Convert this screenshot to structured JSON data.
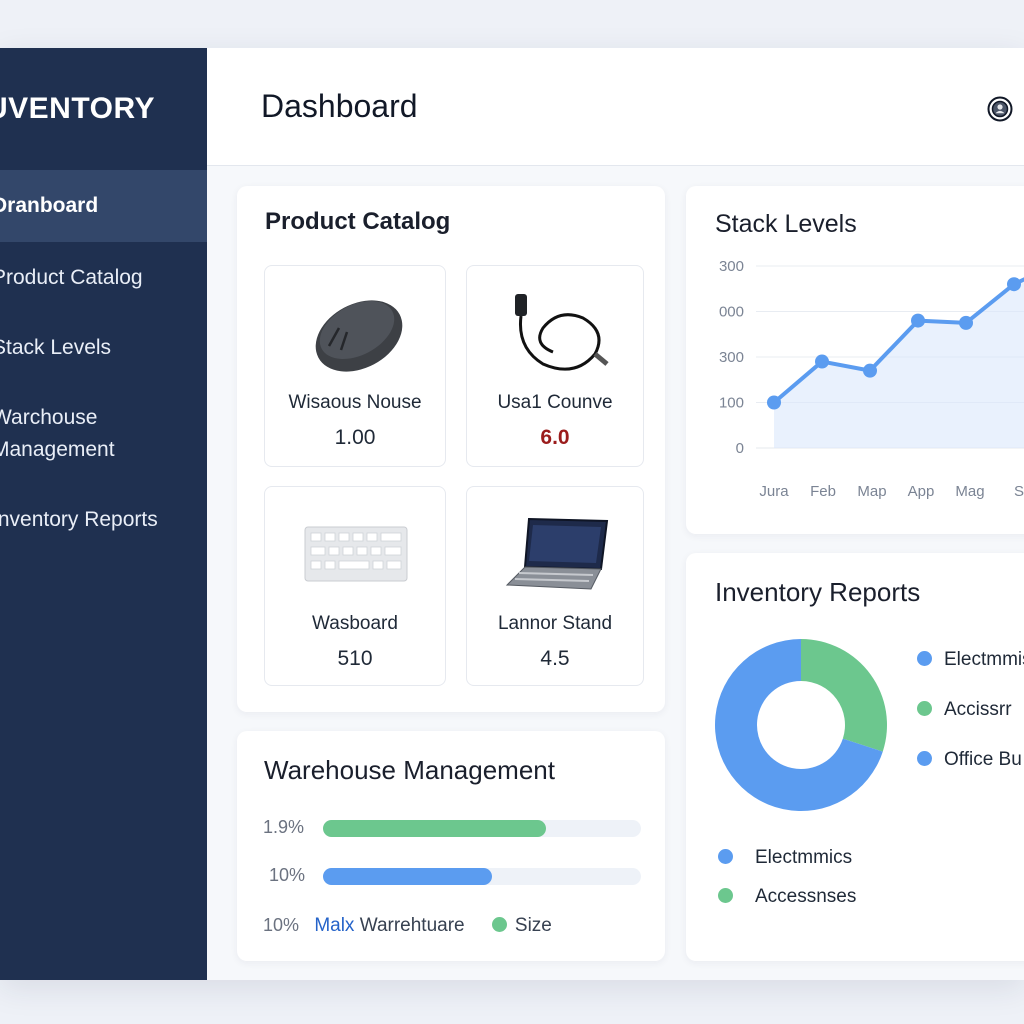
{
  "sidebar": {
    "brand": "UVENTORY",
    "items": [
      {
        "label": "Dranboard",
        "active": true
      },
      {
        "label": "Product Catalog"
      },
      {
        "label": "Stack Levels"
      },
      {
        "label": "Warchouse Management",
        "line1": "Warchouse",
        "line2": "Management"
      },
      {
        "label": "Inventory Reports"
      }
    ]
  },
  "header": {
    "title": "Dashboard",
    "icon": "user-circle-icon"
  },
  "catalog": {
    "title": "Product Catalog",
    "products": [
      {
        "name": "Wisaous Nouse",
        "value": "1.00",
        "icon": "mouse-icon"
      },
      {
        "name": "Usa1 Counve",
        "value": "6.0",
        "icon": "cable-icon",
        "highlight": "#9b1c1c"
      },
      {
        "name": "Wasboard",
        "value": "510",
        "icon": "keyboard-icon"
      },
      {
        "name": "Lannor Stand",
        "value": "4.5",
        "icon": "laptop-icon"
      }
    ]
  },
  "warehouse": {
    "title": "Warehouse Management",
    "bars": [
      {
        "pct_label": "1.9%",
        "fill": 0.7,
        "color": "#6cc78e"
      },
      {
        "pct_label": "10%",
        "fill": 0.53,
        "color": "#5b9cf0"
      }
    ],
    "legend_pct": "10%",
    "legend_label_a": "Malx",
    "legend_label_b": "Warrehtuare",
    "legend_size": "Size",
    "legend_size_color": "#6cc78e"
  },
  "stock": {
    "title": "Stack Levels"
  },
  "reports": {
    "title": "Inventory Reports",
    "legend": [
      {
        "label": "Electmmis",
        "color": "#5b9cf0"
      },
      {
        "label": "Accissrr",
        "color": "#6cc78e"
      },
      {
        "label": "Office Bu",
        "color": "#5b9cf0"
      }
    ],
    "bottom_legend": [
      {
        "label": "Electmmics",
        "color": "#5b9cf0"
      },
      {
        "label": "Accessnses",
        "color": "#6cc78e"
      }
    ]
  },
  "chart_data": [
    {
      "type": "line",
      "title": "Stack Levels",
      "categories": [
        "Jura",
        "Feb",
        "Map",
        "App",
        "Mag",
        "S"
      ],
      "y_tick_labels": [
        "0",
        "100",
        "300",
        "000",
        "300"
      ],
      "values": [
        100,
        190,
        170,
        280,
        275,
        360,
        410
      ],
      "ylim": [
        0,
        400
      ],
      "grid": true,
      "color": "#5b9cf0"
    },
    {
      "type": "pie",
      "title": "Inventory Reports",
      "donut": true,
      "slices": [
        {
          "label": "Accissrr",
          "value": 30,
          "color": "#6cc78e"
        },
        {
          "label": "Electmmis",
          "value": 70,
          "color": "#5b9cf0"
        }
      ]
    }
  ]
}
